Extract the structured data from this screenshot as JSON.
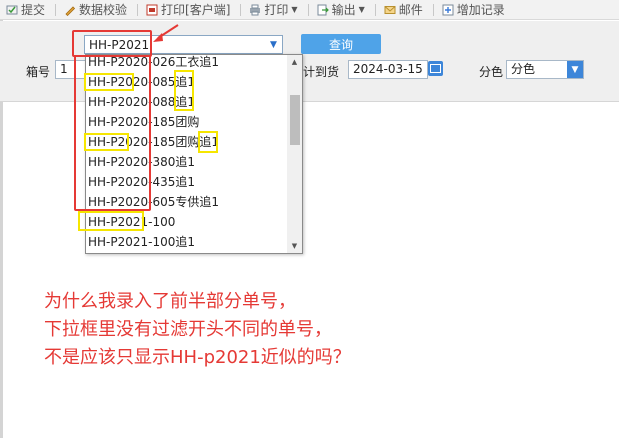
{
  "toolbar": {
    "items": [
      {
        "label": "提交"
      },
      {
        "label": "数据校验"
      },
      {
        "label": "打印[客户端]"
      },
      {
        "label": "打印"
      },
      {
        "label": "输出"
      },
      {
        "label": "邮件"
      },
      {
        "label": "增加记录"
      }
    ]
  },
  "filters": {
    "order_combo_value": "HH-P2021",
    "query_button": "查询",
    "box_label": "箱号",
    "box_value": "1",
    "delivery_label": "计到货",
    "delivery_date": "2024-03-15",
    "color_label": "分色",
    "color_value": "分色"
  },
  "dropdown": {
    "items": [
      "HH-P2020-026工衣追1",
      "HH-P2020-085追1",
      "HH-P2020-088追1",
      "HH-P2020-185团购",
      "HH-P2020-185团购追1",
      "HH-P2020-380追1",
      "HH-P2020-435追1",
      "HH-P2020-605专供追1",
      "HH-P2021-100",
      "HH-P2021-100追1"
    ]
  },
  "annotation": {
    "lines": [
      "为什么我录入了前半部分单号，",
      "下拉框里没有过滤开头不同的单号，",
      "不是应该只显示HH-p2021近似的吗？"
    ],
    "color": "#e53935",
    "highlight_color": "#f6e600"
  }
}
